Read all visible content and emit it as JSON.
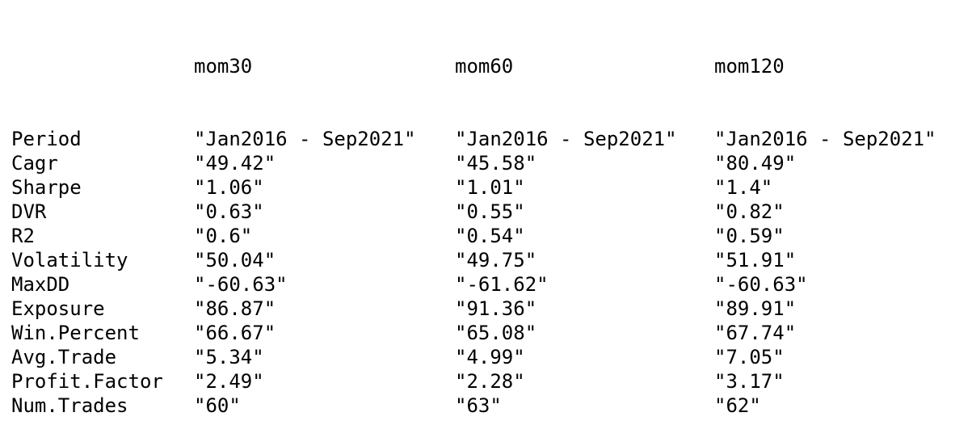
{
  "table": {
    "columns": [
      "mom30",
      "mom60",
      "mom120"
    ],
    "rows": [
      {
        "label": "Period",
        "values": [
          "\"Jan2016 - Sep2021\"",
          "\"Jan2016 - Sep2021\"",
          "\"Jan2016 - Sep2021\""
        ]
      },
      {
        "label": "Cagr",
        "values": [
          "\"49.42\"",
          "\"45.58\"",
          "\"80.49\""
        ]
      },
      {
        "label": "Sharpe",
        "values": [
          "\"1.06\"",
          "\"1.01\"",
          "\"1.4\""
        ]
      },
      {
        "label": "DVR",
        "values": [
          "\"0.63\"",
          "\"0.55\"",
          "\"0.82\""
        ]
      },
      {
        "label": "R2",
        "values": [
          "\"0.6\"",
          "\"0.54\"",
          "\"0.59\""
        ]
      },
      {
        "label": "Volatility",
        "values": [
          "\"50.04\"",
          "\"49.75\"",
          "\"51.91\""
        ]
      },
      {
        "label": "MaxDD",
        "values": [
          "\"-60.63\"",
          "\"-61.62\"",
          "\"-60.63\""
        ]
      },
      {
        "label": "Exposure",
        "values": [
          "\"86.87\"",
          "\"91.36\"",
          "\"89.91\""
        ]
      },
      {
        "label": "Win.Percent",
        "values": [
          "\"66.67\"",
          "\"65.08\"",
          "\"67.74\""
        ]
      },
      {
        "label": "Avg.Trade",
        "values": [
          "\"5.34\"",
          "\"4.99\"",
          "\"7.05\""
        ]
      },
      {
        "label": "Profit.Factor",
        "values": [
          "\"2.49\"",
          "\"2.28\"",
          "\"3.17\""
        ]
      },
      {
        "label": "Num.Trades",
        "values": [
          "\"60\"",
          "\"63\"",
          "\"62\""
        ]
      }
    ]
  }
}
